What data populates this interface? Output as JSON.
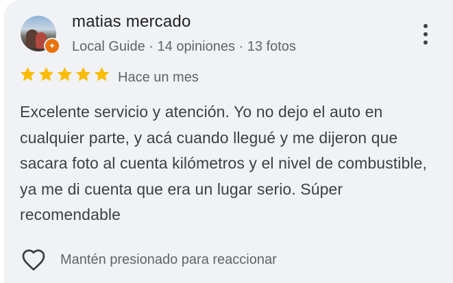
{
  "reviewer": {
    "name": "matias mercado",
    "meta": "Local Guide · 14 opiniones · 13 fotos",
    "badge_icon": "local-guide-star"
  },
  "rating": {
    "stars": 5,
    "max": 5,
    "color": "#fbbc04",
    "time": "Hace un mes"
  },
  "review": {
    "text": "Excelente servicio y atención. Yo no dejo el auto en cualquier parte, y acá cuando llegué y me dijeron que sacara foto al cuenta kilómetros y el nivel de combustible, ya me di cuenta que era un lugar serio. Súper recomendable"
  },
  "reaction": {
    "label": "Mantén presionado para reaccionar",
    "icon": "heart-outline-icon"
  },
  "menu": {
    "icon": "more-vert-icon"
  }
}
